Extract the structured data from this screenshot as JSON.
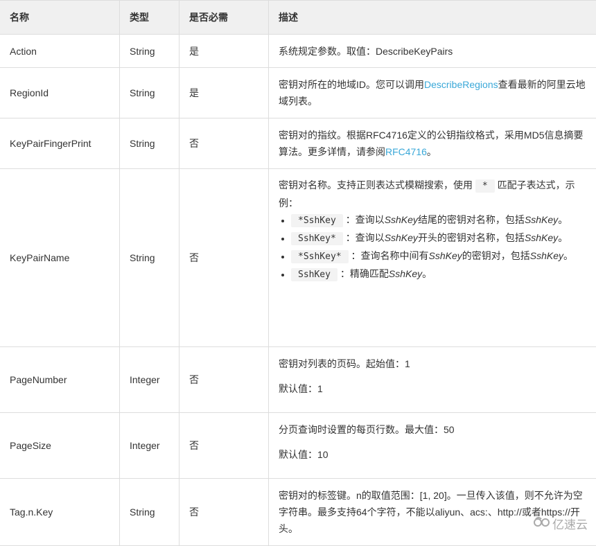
{
  "table": {
    "headers": [
      "名称",
      "类型",
      "是否必需",
      "描述"
    ],
    "rows": [
      {
        "name": "Action",
        "type": "String",
        "required": "是",
        "desc": {
          "text": "系统规定参数。取值：DescribeKeyPairs"
        }
      },
      {
        "name": "RegionId",
        "type": "String",
        "required": "是",
        "desc": {
          "before": "密钥对所在的地域ID。您可以调用",
          "link": "DescribeRegions",
          "after": "查看最新的阿里云地域列表。"
        }
      },
      {
        "name": "KeyPairFingerPrint",
        "type": "String",
        "required": "否",
        "desc": {
          "before": "密钥对的指纹。根据RFC4716定义的公钥指纹格式，采用MD5信息摘要算法。更多详情，请参阅",
          "link": "RFC4716",
          "after": "。"
        }
      },
      {
        "name": "KeyPairName",
        "type": "String",
        "required": "否",
        "desc": {
          "intro_before": "密钥对名称。支持正则表达式模糊搜索，使用",
          "intro_code": "*",
          "intro_after": "匹配子表达式，示例：",
          "examples": [
            {
              "code": "*SshKey",
              "text_a": "：查询以",
              "em": "SshKey",
              "text_b": "结尾的密钥对名称，包括",
              "em2": "SshKey",
              "text_c": "。"
            },
            {
              "code": "SshKey*",
              "text_a": "：查询以",
              "em": "SshKey",
              "text_b": "开头的密钥对名称，包括",
              "em2": "SshKey",
              "text_c": "。"
            },
            {
              "code": "*SshKey*",
              "text_a": "：查询名称中间有",
              "em": "SshKey",
              "text_b": "的密钥对，包括",
              "em2": "SshKey",
              "text_c": "。"
            },
            {
              "code": "SshKey",
              "text_a": "：精确匹配",
              "em": "SshKey",
              "text_b": "。",
              "em2": "",
              "text_c": ""
            }
          ]
        }
      },
      {
        "name": "PageNumber",
        "type": "Integer",
        "required": "否",
        "desc": {
          "line1": "密钥对列表的页码。起始值：1",
          "line2": "默认值：1"
        }
      },
      {
        "name": "PageSize",
        "type": "Integer",
        "required": "否",
        "desc": {
          "line1": "分页查询时设置的每页行数。最大值：50",
          "line2": "默认值：10"
        }
      },
      {
        "name": "Tag.n.Key",
        "type": "String",
        "required": "否",
        "desc": {
          "text": "密钥对的标签键。n的取值范围：[1, 20]。一旦传入该值，则不允许为空字符串。最多支持64个字符，不能以aliyun、acs:、http://或者https://开头。"
        }
      }
    ]
  },
  "watermark": {
    "text": "亿速云",
    "icon": "yisu-cloud-logo-icon"
  },
  "colors": {
    "link": "#3aa8d8",
    "header_bg": "#f0f0f0",
    "border": "#dddddd",
    "code_bg": "#f3f3f3"
  }
}
